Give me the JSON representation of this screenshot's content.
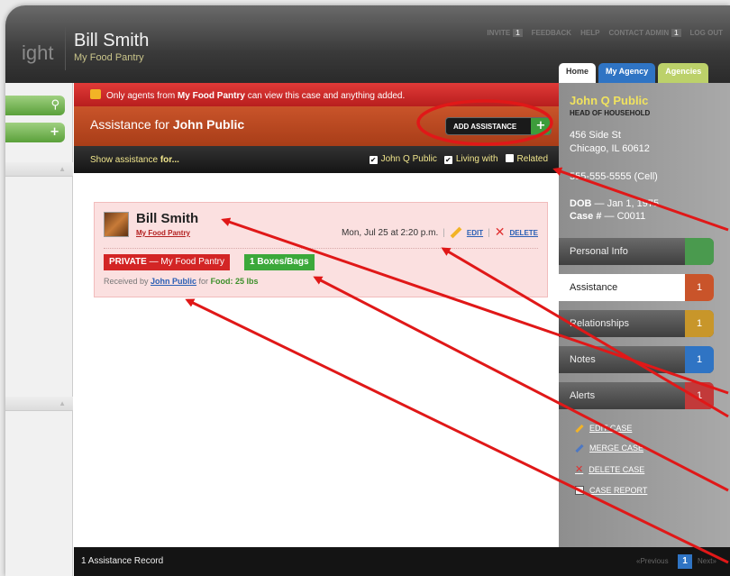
{
  "header": {
    "logo_text": "ight",
    "agent_name": "Bill Smith",
    "agent_org": "My Food Pantry",
    "nav": [
      {
        "label": "INVITE",
        "count": "1"
      },
      {
        "label": "FEEDBACK",
        "count": ""
      },
      {
        "label": "HELP",
        "count": ""
      },
      {
        "label": "CONTACT ADMIN",
        "count": "1"
      },
      {
        "label": "LOG OUT",
        "count": ""
      }
    ],
    "tabs": [
      "Home",
      "My Agency",
      "Agencies"
    ]
  },
  "privacy_notice": {
    "prefix": "Only agents from ",
    "org": "My Food Pantry",
    "suffix": " can view this case and anything added."
  },
  "assistance_header": {
    "prefix": "Assistance for ",
    "name": "John Public",
    "add_button": "ADD ASSISTANCE"
  },
  "filter_bar": {
    "label_prefix": "Show assistance ",
    "label_bold": "for...",
    "options": [
      {
        "label": "John Q Public",
        "checked": true
      },
      {
        "label": "Living with",
        "checked": true
      },
      {
        "label": "Related",
        "checked": false
      }
    ]
  },
  "record": {
    "name": "Bill Smith",
    "org": "My Food Pantry",
    "datetime": "Mon, Jul 25 at 2:20 p.m.",
    "edit": "EDIT",
    "delete": "DELETE",
    "private_label": "PRIVATE",
    "private_sub": " — My Food Pantry",
    "quantity": "1 Boxes/Bags",
    "received_prefix": "Received by ",
    "received_by": "John Public",
    "received_mid": " for ",
    "received_food": "Food: 25 lbs"
  },
  "footer": {
    "count_text": "1 Assistance Record",
    "prev": "«Previous",
    "page": "1",
    "next": "Next»"
  },
  "client": {
    "name": "John Q Public",
    "role": "HEAD OF HOUSEHOLD",
    "address1": "456 Side St",
    "address2": "Chicago, IL 60612",
    "phone": "555-555-5555 (Cell)",
    "dob_label": "DOB",
    "dob_value": " — Jan 1, 1975",
    "case_label": "Case #",
    "case_value": " — C0011"
  },
  "sections": [
    {
      "label": "Personal Info",
      "count": "",
      "color": "#4a9a4e"
    },
    {
      "label": "Assistance",
      "count": "1",
      "color": "#c9542a"
    },
    {
      "label": "Relationships",
      "count": "1",
      "color": "#c8962a"
    },
    {
      "label": "Notes",
      "count": "1",
      "color": "#2f74c4"
    },
    {
      "label": "Alerts",
      "count": "1",
      "color": "#c23a3a"
    }
  ],
  "case_actions": [
    "EDIT CASE",
    "MERGE CASE",
    "DELETE CASE",
    "CASE REPORT"
  ],
  "colors": {
    "annotation_red": "#e01818",
    "private_red": "#d32525",
    "quantity_green": "#3ba83a"
  }
}
